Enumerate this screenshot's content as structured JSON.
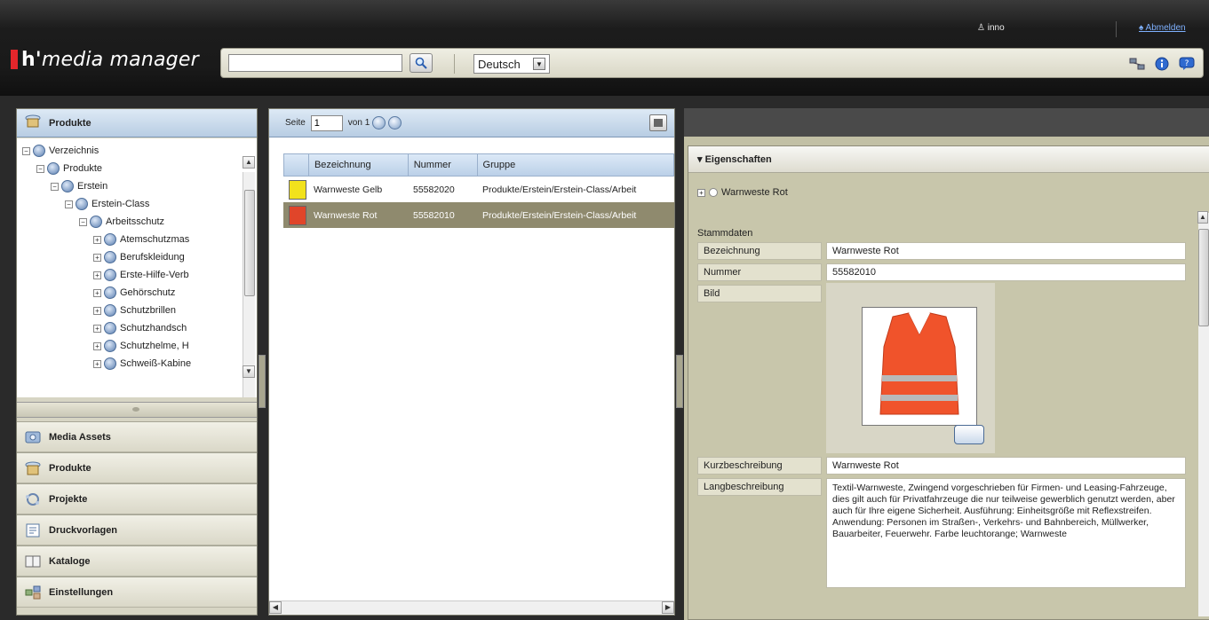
{
  "header": {
    "user_name": "inno",
    "logout_label": "Abmelden",
    "logo_brand": "h'",
    "logo_text": "media manager",
    "search_value": "",
    "language_selected": "Deutsch"
  },
  "left_panel": {
    "title": "Produkte",
    "tree": [
      {
        "label": "Verzeichnis",
        "level": 0,
        "toggle": "−"
      },
      {
        "label": "Produkte",
        "level": 1,
        "toggle": "−"
      },
      {
        "label": "Erstein",
        "level": 2,
        "toggle": "−"
      },
      {
        "label": "Erstein-Class",
        "level": 3,
        "toggle": "−"
      },
      {
        "label": "Arbeitsschutz",
        "level": 4,
        "toggle": "−"
      },
      {
        "label": "Atemschutzmas",
        "level": 5,
        "toggle": "+"
      },
      {
        "label": "Berufskleidung",
        "level": 5,
        "toggle": "+"
      },
      {
        "label": "Erste-Hilfe-Verb",
        "level": 5,
        "toggle": "+"
      },
      {
        "label": "Gehörschutz",
        "level": 5,
        "toggle": "+"
      },
      {
        "label": "Schutzbrillen",
        "level": 5,
        "toggle": "+"
      },
      {
        "label": "Schutzhandsch",
        "level": 5,
        "toggle": "+"
      },
      {
        "label": "Schutzhelme, H",
        "level": 5,
        "toggle": "+"
      },
      {
        "label": "Schweiß-Kabine",
        "level": 5,
        "toggle": "+"
      }
    ],
    "nav": [
      {
        "label": "Media Assets",
        "icon": "media-assets-icon"
      },
      {
        "label": "Produkte",
        "icon": "products-icon"
      },
      {
        "label": "Projekte",
        "icon": "projects-icon"
      },
      {
        "label": "Druckvorlagen",
        "icon": "print-templates-icon"
      },
      {
        "label": "Kataloge",
        "icon": "catalogs-icon"
      },
      {
        "label": "Einstellungen",
        "icon": "settings-icon"
      }
    ]
  },
  "middle_panel": {
    "page_label": "Seite",
    "page_value": "1",
    "of_label": "von 1",
    "columns": [
      "Bezeichnung",
      "Nummer",
      "Gruppe"
    ],
    "rows": [
      {
        "name": "Warnweste Gelb",
        "number": "55582020",
        "group": "Produkte/Erstein/Erstein-Class/Arbeit",
        "color": "#f2e21c",
        "selected": false
      },
      {
        "name": "Warnweste Rot",
        "number": "55582010",
        "group": "Produkte/Erstein/Erstein-Class/Arbeit",
        "color": "#e0452a",
        "selected": true
      }
    ]
  },
  "right_panel": {
    "section_title": "▾ Eigenschaften",
    "item_title": "Warnweste Rot",
    "group_title": "Stammdaten",
    "fields": {
      "bezeichnung_label": "Bezeichnung",
      "bezeichnung_value": "Warnweste Rot",
      "nummer_label": "Nummer",
      "nummer_value": "55582010",
      "bild_label": "Bild",
      "kurz_label": "Kurzbeschreibung",
      "kurz_value": "Warnweste Rot",
      "lang_label": "Langbeschreibung",
      "lang_value": "Textil-Warnweste, Zwingend vorgeschrieben für Firmen- und Leasing-Fahrzeuge, dies gilt auch für Privatfahrzeuge die nur teilweise gewerblich genutzt werden, aber auch für Ihre eigene Sicherheit. Ausführung: Einheitsgröße mit Reflexstreifen. Anwendung: Personen im Straßen-, Verkehrs- und Bahnbereich, Müllwerker, Bauarbeiter, Feuerwehr. Farbe leuchtorange; Warnweste"
    }
  },
  "colors": {
    "brand_red": "#e5262b",
    "selected_row": "#8f8a6e",
    "vest_orange": "#f0532b",
    "vest_stripe": "#b9b9b9"
  }
}
